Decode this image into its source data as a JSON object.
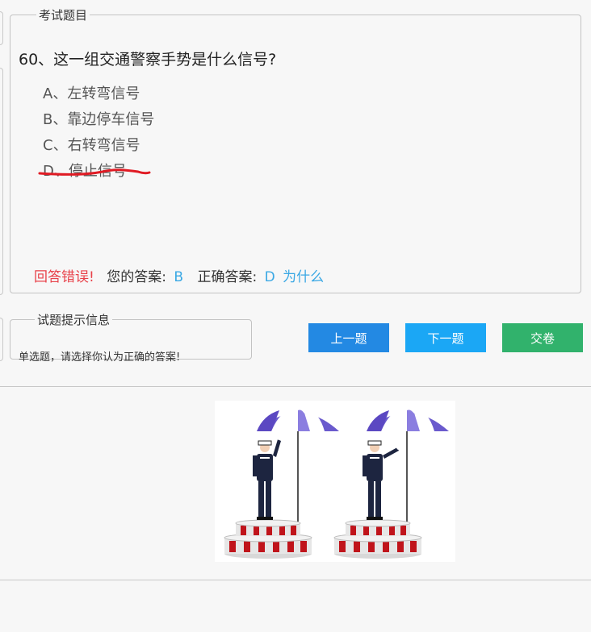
{
  "exam": {
    "legend": "考试题目",
    "question": "60、这一组交通警察手势是什么信号?",
    "options": [
      "A、左转弯信号",
      "B、靠边停车信号",
      "C、右转弯信号",
      "D、停止信号"
    ],
    "result": {
      "status": "回答错误!",
      "your_answer_label": "您的答案:",
      "your_answer": "B",
      "correct_answer_label": "正确答案:",
      "correct_answer": "D",
      "why_link": "为什么"
    }
  },
  "hint": {
    "legend": "试题提示信息",
    "text": "单选题，请选择你认为正确的答案!"
  },
  "buttons": {
    "prev_label": "上一题",
    "next_label": "下一题",
    "submit_label": "交卷"
  },
  "colors": {
    "prev_button": "#2389e3",
    "next_button": "#1ba7f5",
    "submit_button": "#31b26c",
    "error_text": "#e8424a",
    "answer_text": "#3aa8e4",
    "annotation_underline": "#e01b24"
  },
  "image": {
    "description_icon": "traffic-police-gesture-illustration"
  }
}
